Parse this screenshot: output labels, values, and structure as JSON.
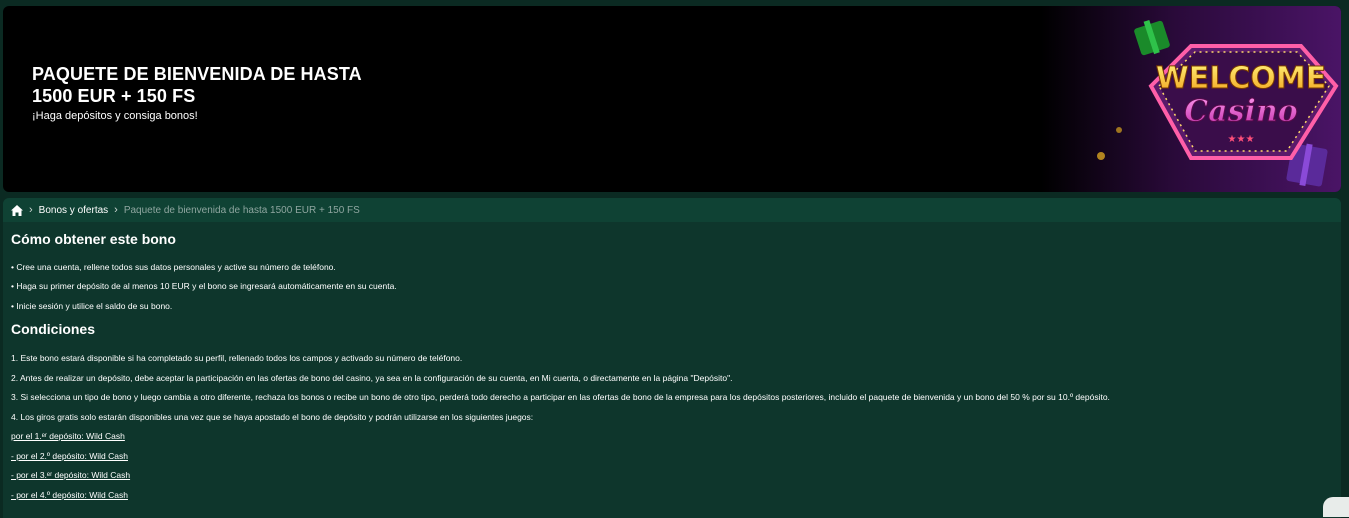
{
  "banner": {
    "title_line1": "PAQUETE DE BIENVENIDA DE HASTA",
    "title_line2": "1500 EUR + 150 FS",
    "subtitle": "¡Haga depósitos y consiga bonos!",
    "art_line1": "WELCOME",
    "art_line2": "Casino"
  },
  "breadcrumb": {
    "home_icon": "home-icon",
    "item1": "Bonos y ofertas",
    "current": "Paquete de bienvenida de hasta 1500 EUR + 150 FS"
  },
  "how": {
    "title": "Cómo obtener este bono",
    "steps": [
      "• Cree una cuenta, rellene todos sus datos personales y active su número de teléfono.",
      "• Haga su primer depósito de al menos 10 EUR y el bono se ingresará automáticamente en su cuenta.",
      "• Inicie sesión y utilice el saldo de su bono."
    ]
  },
  "conditions": {
    "title": "Condiciones",
    "items": [
      "1. Este bono estará disponible si ha completado su perfil, rellenado todos los campos y activado su número de teléfono.",
      "2. Antes de realizar un depósito, debe aceptar la participación en las ofertas de bono del casino, ya sea en la configuración de su cuenta, en Mi cuenta, o directamente en la página \"Depósito\".",
      "3. Si selecciona un tipo de bono y luego cambia a otro diferente, rechaza los bonos o recibe un bono de otro tipo, perderá todo derecho a participar en las ofertas de bono de la empresa para los depósitos posteriores, incluido el paquete de bienvenida y un bono del 50 % por su 10.º depósito.",
      "4. Los giros gratis solo estarán disponibles una vez que se haya apostado el bono de depósito y podrán utilizarse en los siguientes juegos:"
    ],
    "games": [
      "por el 1.ᵉʳ depósito: Wild Cash",
      "- por el 2.º depósito: Wild Cash",
      "- por el 3.ᵉʳ depósito: Wild Cash",
      "- por el 4.º depósito: Wild Cash"
    ]
  }
}
